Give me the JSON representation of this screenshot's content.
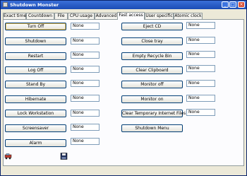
{
  "window": {
    "title": "Shutdown Monster"
  },
  "tabs": [
    {
      "label": "Exact time"
    },
    {
      "label": "Countdown"
    },
    {
      "label": "File"
    },
    {
      "label": "CPU usage"
    },
    {
      "label": "Advanced"
    },
    {
      "label": "Fast access",
      "active": true
    },
    {
      "label": "User specific"
    },
    {
      "label": "Atomic clock"
    }
  ],
  "left_column": [
    {
      "label": "Turn Off",
      "value": "None"
    },
    {
      "label": "Shutdown",
      "value": "None"
    },
    {
      "label": "Restart",
      "value": "None"
    },
    {
      "label": "Log Off",
      "value": "None"
    },
    {
      "label": "Stand By",
      "value": "None"
    },
    {
      "label": "Hibernate",
      "value": "None"
    },
    {
      "label": "Lock Workstation",
      "value": "None"
    },
    {
      "label": "Screensaver",
      "value": "None"
    },
    {
      "label": "Alarm",
      "value": "None"
    }
  ],
  "right_column": [
    {
      "label": "Eject CD",
      "value": "None"
    },
    {
      "label": "Close tray",
      "value": "None"
    },
    {
      "label": "Empty Recycle Bin",
      "value": "None"
    },
    {
      "label": "Clear Clipboard",
      "value": "None"
    },
    {
      "label": "Monitor off",
      "value": "None"
    },
    {
      "label": "Monitor on",
      "value": "None"
    },
    {
      "label": "Clear Temporary Internet Files",
      "value": "None"
    },
    {
      "label": "Shutdown Menu",
      "value": ""
    }
  ],
  "bottom_icons": [
    {
      "name": "car-icon"
    },
    {
      "name": "save-icon"
    }
  ],
  "colors": {
    "titlebar": "#1b4cb5",
    "panel": "#fcfcfe",
    "window": "#ece9d8",
    "button_border": "#003c74"
  }
}
